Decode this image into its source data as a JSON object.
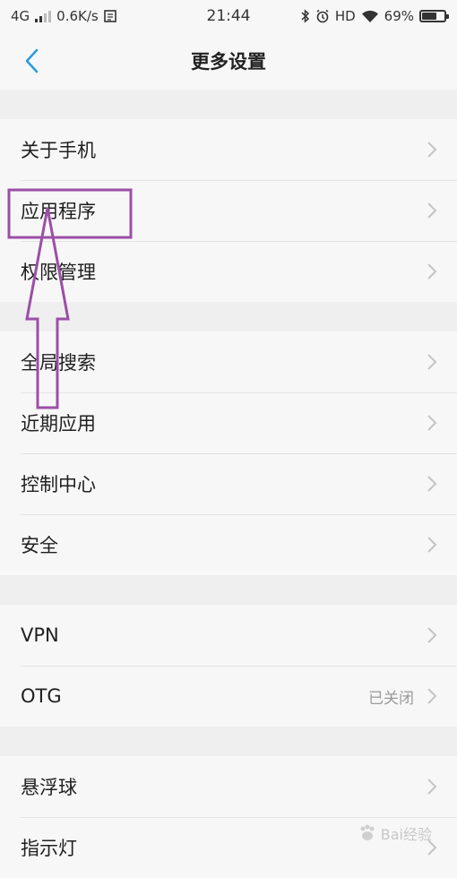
{
  "status_bar": {
    "network": "4G",
    "speed": "0.6K/s",
    "time": "21:44",
    "hd": "HD",
    "battery": "69%",
    "battery_level": 0.69
  },
  "header": {
    "title": "更多设置"
  },
  "groups": [
    {
      "items": [
        {
          "label": "关于手机"
        },
        {
          "label": "应用程序"
        },
        {
          "label": "权限管理"
        }
      ]
    },
    {
      "items": [
        {
          "label": "全局搜索"
        },
        {
          "label": "近期应用"
        },
        {
          "label": "控制中心"
        },
        {
          "label": "安全"
        }
      ]
    },
    {
      "items": [
        {
          "label": "VPN"
        },
        {
          "label": "OTG",
          "value": "已关闭"
        }
      ]
    },
    {
      "items": [
        {
          "label": "悬浮球"
        },
        {
          "label": "指示灯"
        }
      ]
    }
  ],
  "watermark": {
    "text": "Bai经验"
  },
  "colors": {
    "accent": "#2f9bdf",
    "annotation": "#9b4fa6"
  }
}
